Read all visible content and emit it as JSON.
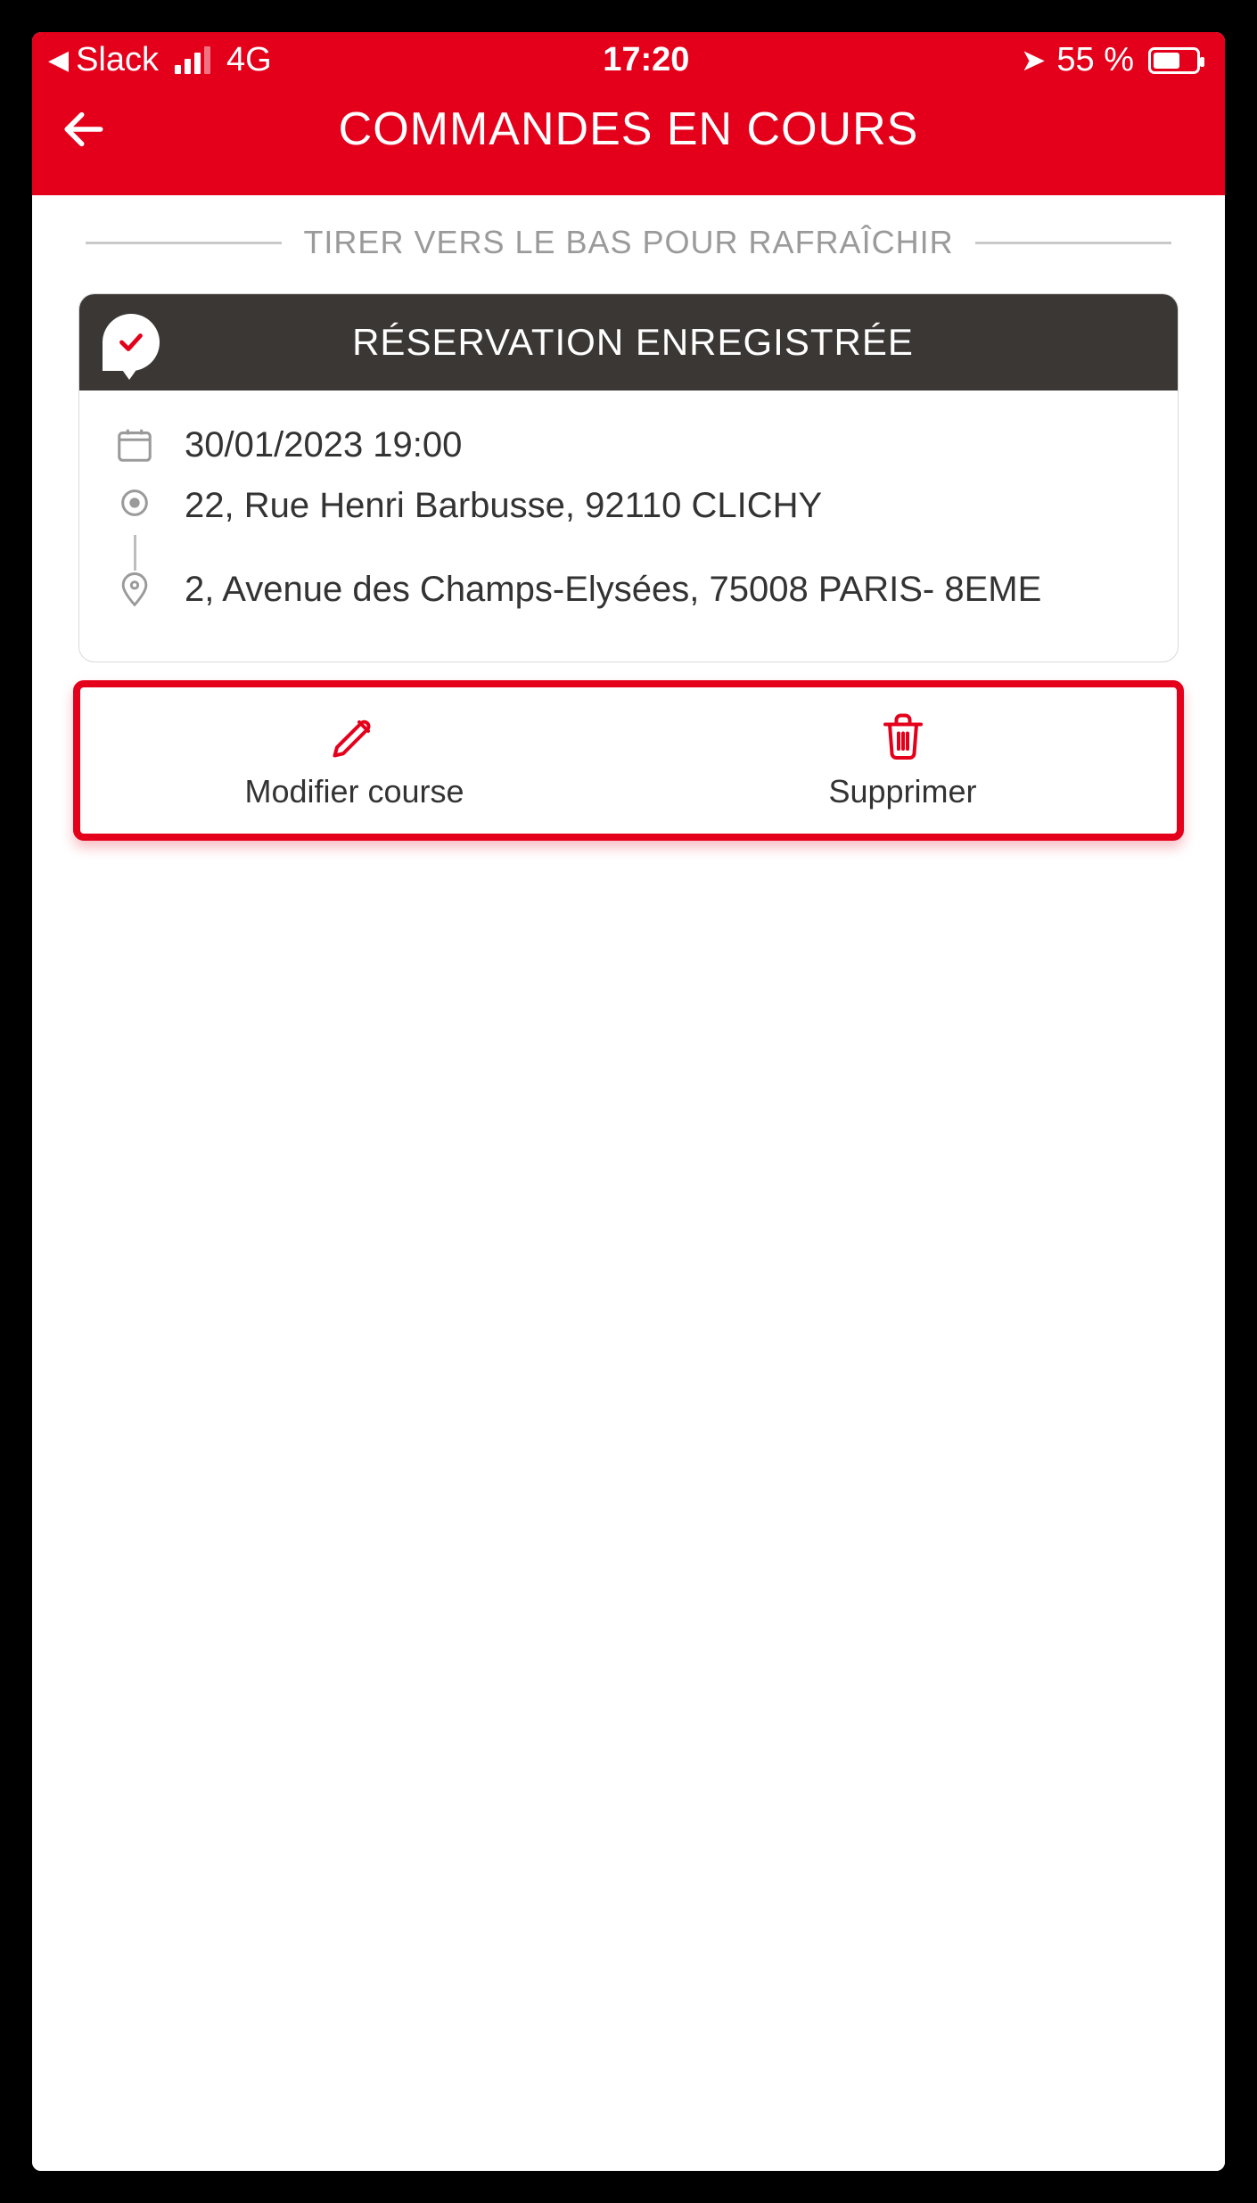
{
  "status_bar": {
    "back_app": "Slack",
    "network": "4G",
    "time": "17:20",
    "battery_pct": "55 %",
    "battery_level": 55
  },
  "header": {
    "title": "COMMANDES EN COURS"
  },
  "pull_hint": "TIRER VERS LE BAS POUR RAFRAÎCHIR",
  "reservation": {
    "status_title": "RÉSERVATION ENREGISTRÉE",
    "datetime": "30/01/2023 19:00",
    "origin": "22, Rue Henri Barbusse, 92110 CLICHY",
    "destination": "2, Avenue des Champs-Elysées, 75008 PARIS- 8EME"
  },
  "actions": {
    "modify": "Modifier course",
    "delete": "Supprimer"
  },
  "colors": {
    "brand_red": "#e4001b",
    "card_header": "#3b3735"
  }
}
